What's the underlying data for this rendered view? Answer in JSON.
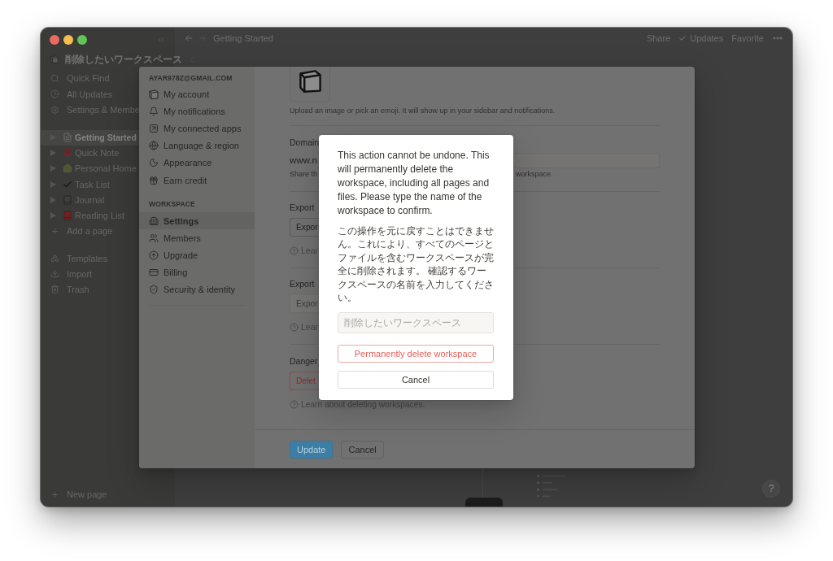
{
  "topbar": {
    "breadcrumb": "Getting Started",
    "actions": [
      {
        "label": "Share",
        "kind": "text"
      },
      {
        "label": "Updates",
        "kind": "tick"
      },
      {
        "label": "Favorite",
        "kind": "text"
      }
    ]
  },
  "sidebar": {
    "workspace": "削除したいワークスペース",
    "nav": [
      "Quick Find",
      "All Updates",
      "Settings & Membe"
    ],
    "pages": [
      {
        "label": "Getting Started",
        "selected": true
      },
      {
        "label": "Quick Note",
        "selected": false
      },
      {
        "label": "Personal Home",
        "selected": false
      },
      {
        "label": "Task List",
        "selected": false
      },
      {
        "label": "Journal",
        "selected": false
      },
      {
        "label": "Reading List",
        "selected": false
      }
    ],
    "add_page": "Add a page",
    "tools": [
      "Templates",
      "Import",
      "Trash"
    ],
    "new_page": "New page"
  },
  "settings": {
    "account_email": "AYAR978Z@GMAIL.COM",
    "account_items": [
      {
        "label": "My account",
        "selected": false
      },
      {
        "label": "My notifications",
        "selected": false
      },
      {
        "label": "My connected apps",
        "selected": false
      },
      {
        "label": "Language & region",
        "selected": false
      },
      {
        "label": "Appearance",
        "selected": false
      },
      {
        "label": "Earn credit",
        "selected": false
      }
    ],
    "workspace_heading": "WORKSPACE",
    "workspace_items": [
      {
        "label": "Settings",
        "selected": true
      },
      {
        "label": "Members",
        "selected": false
      },
      {
        "label": "Upgrade",
        "selected": false
      },
      {
        "label": "Billing",
        "selected": false
      },
      {
        "label": "Security & identity",
        "selected": false
      }
    ],
    "icon_hint": "Upload an image or pick an emoji. It will show up in your sidebar and notifications.",
    "sections": [
      {
        "kind": "domain",
        "label": "Domain",
        "value": "www.n",
        "hint": "Share th",
        "hint_tail": "workspace."
      },
      {
        "kind": "export",
        "label": "Export",
        "button": {
          "label": "Expor",
          "disabled": false
        },
        "help": "Lear"
      },
      {
        "kind": "export",
        "label": "Export",
        "button": {
          "label": "Expor",
          "disabled": true
        },
        "help": "Lear"
      },
      {
        "kind": "danger",
        "label": "Danger",
        "button": {
          "label": "Delet"
        },
        "help": "Learn about deleting workspaces."
      }
    ],
    "footer_buttons": [
      {
        "label": "Update",
        "kind": "primary"
      },
      {
        "label": "Cancel",
        "kind": "secondary"
      }
    ]
  },
  "confirm_dialog": {
    "message": "This action cannot be undone. This will permanently delete the workspace, including all pages and files. Please type the name of the workspace to confirm.",
    "message_ja": "この操作を元に戻すことはできません。これにより、すべてのページとファイルを含むワークスペースが完全に削除されます。 確認するワークスペースの名前を入力してください。",
    "input": {
      "placeholder": "削除したいワークスペース"
    },
    "buttons": [
      {
        "label": "Permanently delete workspace",
        "kind": "danger"
      },
      {
        "label": "Cancel",
        "kind": "default"
      }
    ]
  },
  "help_button": "?"
}
